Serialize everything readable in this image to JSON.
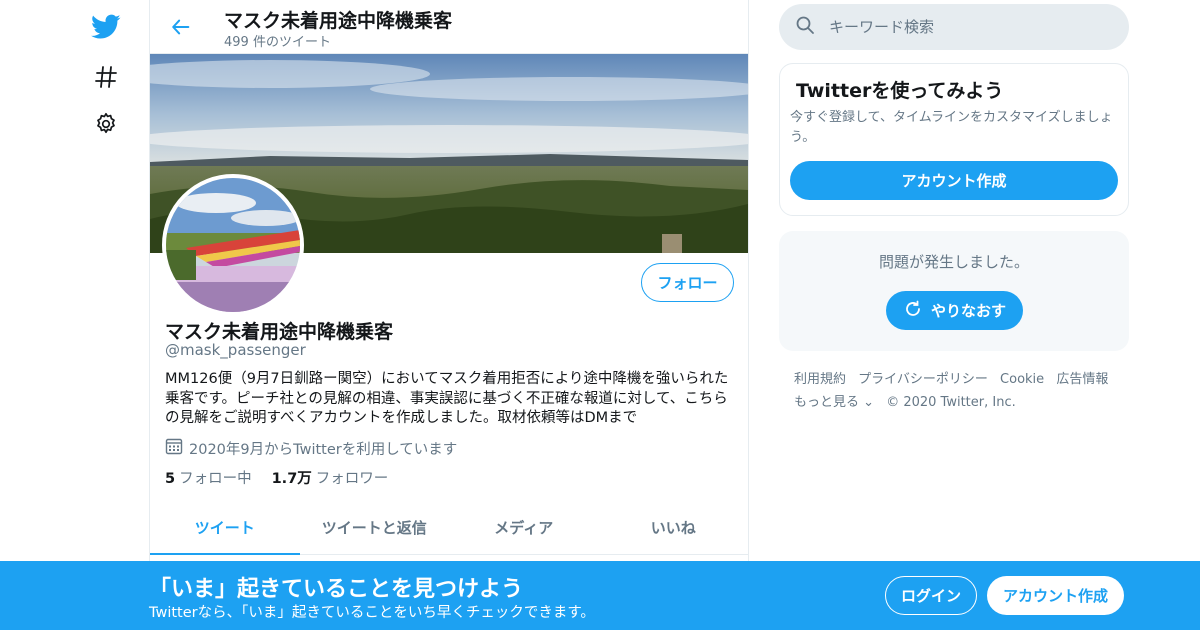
{
  "colors": {
    "accent": "#1da1f2",
    "text": "#14171a",
    "muted": "#657786",
    "border": "#e6ecf0"
  },
  "nav": {
    "icons": [
      "twitter-bird-icon",
      "hashtag-icon",
      "gear-icon"
    ]
  },
  "header": {
    "title": "マスク未着用途中降機乗客",
    "subtitle": "499 件のツイート"
  },
  "profile": {
    "display_name": "マスク未着用途中降機乗客",
    "handle": "@mask_passenger",
    "follow_label": "フォロー",
    "bio": "MM126便（9月7日釧路ー関空）においてマスク着用拒否により途中降機を強いられた乗客です。ピーチ社との見解の相違、事実誤認に基づく不正確な報道に対して、こちらの見解をご説明すべくアカウントを作成しました。取材依頼等はDMまで",
    "joined": "2020年9月からTwitterを利用しています",
    "following_count": "5",
    "following_label": "フォロー中",
    "followers_count": "1.7万",
    "followers_label": "フォロワー"
  },
  "tabs": [
    {
      "label": "ツイート",
      "active": true
    },
    {
      "label": "ツイートと返信",
      "active": false
    },
    {
      "label": "メディア",
      "active": false
    },
    {
      "label": "いいね",
      "active": false
    }
  ],
  "sidebar": {
    "search_placeholder": "キーワード検索",
    "signup_card": {
      "title": "Twitterを使ってみよう",
      "description": "今すぐ登録して、タイムラインをカスタマイズしましょう。",
      "button": "アカウント作成"
    },
    "error_card": {
      "message": "問題が発生しました。",
      "retry": "やりなおす"
    },
    "footer": {
      "links": [
        "利用規約",
        "プライバシーポリシー",
        "Cookie",
        "広告情報",
        "もっと見る"
      ],
      "copyright": "© 2020 Twitter, Inc."
    }
  },
  "bottom_bar": {
    "title": "「いま」起きていることを見つけよう",
    "subtitle": "Twitterなら、「いま」起きていることをいち早くチェックできます。",
    "login": "ログイン",
    "signup": "アカウント作成"
  }
}
